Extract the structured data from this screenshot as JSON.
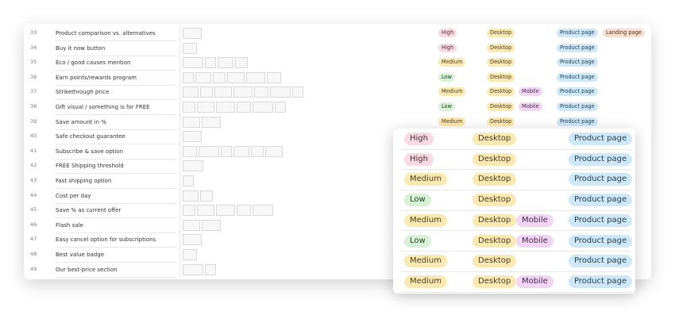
{
  "rows": [
    {
      "num": "33",
      "name": "Product comparison vs. alternatives",
      "thumbs": 1,
      "priority": "High",
      "device": [
        "Desktop"
      ],
      "pages": [
        "Product page",
        "Landing page"
      ]
    },
    {
      "num": "34",
      "name": "Buy it now button",
      "thumbs": 1,
      "priority": "High",
      "device": [
        "Desktop"
      ],
      "pages": [
        "Product page"
      ]
    },
    {
      "num": "35",
      "name": "Eco / good causes mention",
      "thumbs": 4,
      "priority": "Medium",
      "device": [
        "Desktop"
      ],
      "pages": [
        "Product page"
      ]
    },
    {
      "num": "36",
      "name": "Earn points/rewards program",
      "thumbs": 6,
      "priority": "Low",
      "device": [
        "Desktop"
      ],
      "pages": [
        "Product page"
      ]
    },
    {
      "num": "37",
      "name": "Strikethrough price",
      "thumbs": 7,
      "priority": "Medium",
      "device": [
        "Desktop",
        "Mobile"
      ],
      "pages": [
        "Product page"
      ]
    },
    {
      "num": "38",
      "name": "Gift visual / something is for FREE",
      "thumbs": 6,
      "priority": "Low",
      "device": [
        "Desktop",
        "Mobile"
      ],
      "pages": [
        "Product page"
      ]
    },
    {
      "num": "39",
      "name": "Save amount in %",
      "thumbs": 2,
      "priority": "Medium",
      "device": [
        "Desktop"
      ],
      "pages": [
        "Product page"
      ]
    },
    {
      "num": "40",
      "name": "Safe checkout guarantee",
      "thumbs": 1,
      "priority": "",
      "device": [],
      "pages": []
    },
    {
      "num": "41",
      "name": "Subscribe & save option",
      "thumbs": 6,
      "priority": "",
      "device": [],
      "pages": []
    },
    {
      "num": "42",
      "name": "FREE Shipping threshold",
      "thumbs": 1,
      "priority": "",
      "device": [],
      "pages": []
    },
    {
      "num": "43",
      "name": "Fast shipping option",
      "thumbs": 1,
      "priority": "",
      "device": [],
      "pages": []
    },
    {
      "num": "44",
      "name": "Cost per day",
      "thumbs": 2,
      "priority": "",
      "device": [],
      "pages": []
    },
    {
      "num": "45",
      "name": "Save % as current offer",
      "thumbs": 5,
      "priority": "",
      "device": [],
      "pages": []
    },
    {
      "num": "46",
      "name": "Flash sale",
      "thumbs": 2,
      "priority": "",
      "device": [],
      "pages": []
    },
    {
      "num": "47",
      "name": "Easy cancel option for subscriptions",
      "thumbs": 1,
      "priority": "",
      "device": [],
      "pages": []
    },
    {
      "num": "48",
      "name": "Best value badge",
      "thumbs": 1,
      "priority": "",
      "device": [],
      "pages": []
    },
    {
      "num": "49",
      "name": "Our best-price section",
      "thumbs": 2,
      "priority": "",
      "device": [],
      "pages": []
    }
  ],
  "popup_rows": [
    {
      "priority": "High",
      "device": [
        "Desktop"
      ],
      "pages": [
        "Product page"
      ]
    },
    {
      "priority": "High",
      "device": [
        "Desktop"
      ],
      "pages": [
        "Product page"
      ]
    },
    {
      "priority": "Medium",
      "device": [
        "Desktop"
      ],
      "pages": [
        "Product page"
      ]
    },
    {
      "priority": "Low",
      "device": [
        "Desktop"
      ],
      "pages": [
        "Product page"
      ]
    },
    {
      "priority": "Medium",
      "device": [
        "Desktop",
        "Mobile"
      ],
      "pages": [
        "Product page"
      ]
    },
    {
      "priority": "Low",
      "device": [
        "Desktop",
        "Mobile"
      ],
      "pages": [
        "Product page"
      ]
    },
    {
      "priority": "Medium",
      "device": [
        "Desktop"
      ],
      "pages": [
        "Product page"
      ]
    },
    {
      "priority": "Medium",
      "device": [
        "Desktop",
        "Mobile"
      ],
      "pages": [
        "Product page"
      ]
    }
  ],
  "colors": {
    "High": "#f9d9e2",
    "Medium": "#fbe9b4",
    "Low": "#d8f1d7",
    "Desktop": "#fbe9b4",
    "Mobile": "#f0d6f3",
    "Product page": "#cfe8f7",
    "Landing page": "#f9dfcf"
  }
}
